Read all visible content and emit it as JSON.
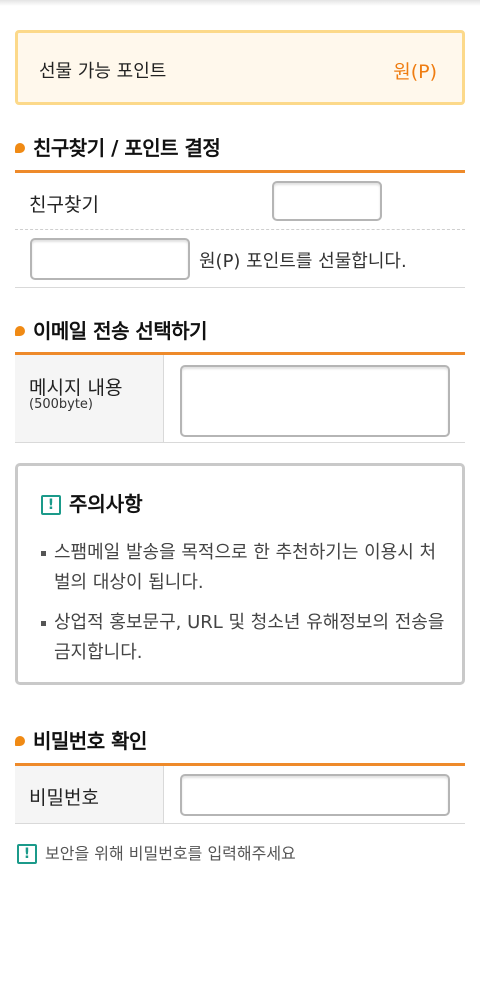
{
  "gift_points": {
    "label": "선물 가능 포인트",
    "unit": "원(P)"
  },
  "friend_section": {
    "title": "친구찾기 / 포인트 결정",
    "find_friend_label": "친구찾기",
    "find_friend_value": "",
    "points_value": "",
    "points_suffix": "원(P) 포인트를 선물합니다."
  },
  "email_section": {
    "title": "이메일 전송 선택하기",
    "message_label": "메시지 내용",
    "message_limit": "(500byte)",
    "message_value": ""
  },
  "notice": {
    "icon": "exclamation-icon",
    "title": "주의사항",
    "items": [
      "스팸메일 발송을 목적으로 한 추천하기는 이용시 처벌의 대상이 됩니다.",
      "상업적 홍보문구, URL 및 청소년 유해정보의 전송을 금지합니다."
    ]
  },
  "password_section": {
    "title": "비밀번호 확인",
    "password_label": "비밀번호",
    "password_value": "",
    "hint": "보안을 위해 비밀번호를 입력해주세요"
  },
  "colors": {
    "accent": "#ee8a2a",
    "points_unit": "#ef7d12",
    "notice_icon": "#1b9a8a"
  }
}
